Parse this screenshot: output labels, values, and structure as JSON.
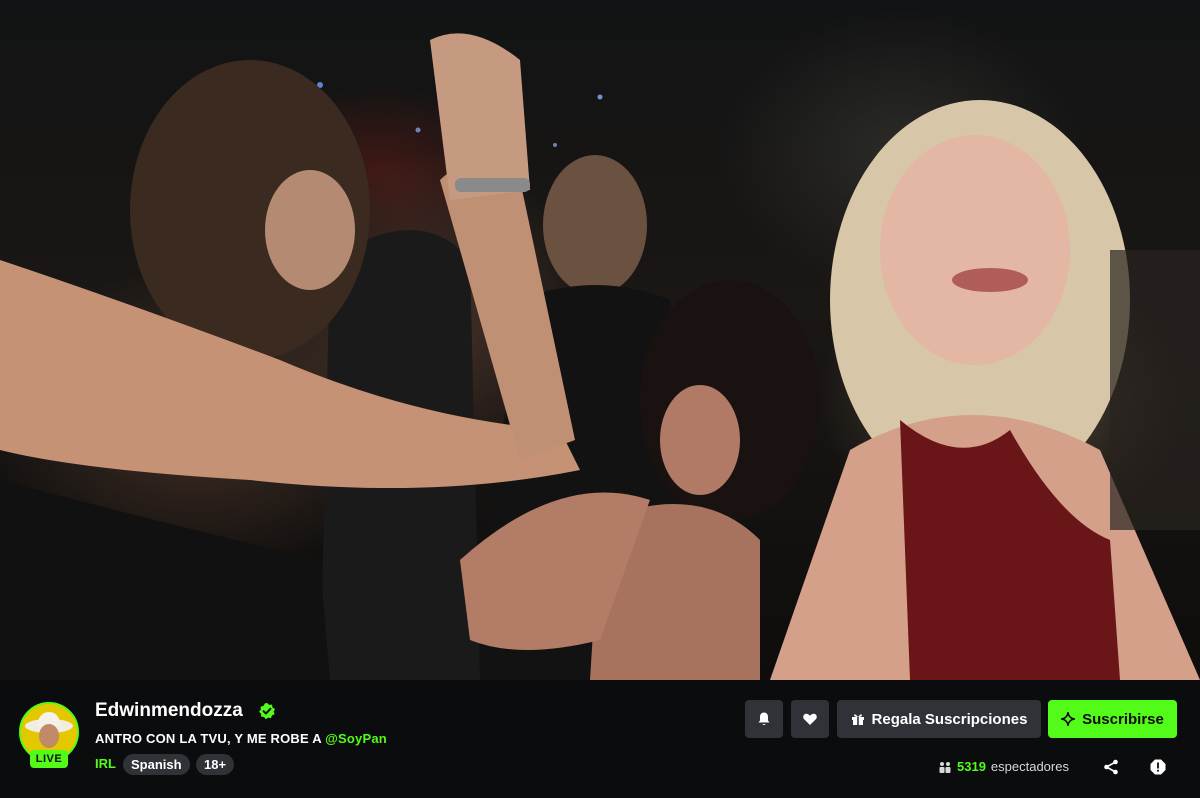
{
  "channel": {
    "name": "Edwinmendozza",
    "live_label": "LIVE",
    "verified_icon": "verified-badge-icon"
  },
  "stream": {
    "title_prefix": "ANTRO CON LA TVU, Y ME ROBE A ",
    "title_mention": "@SoyPan",
    "category": "IRL",
    "tags": [
      "Spanish",
      "18+"
    ]
  },
  "actions": {
    "notify_icon": "bell-icon",
    "follow_icon": "heart-icon",
    "gift_label": "Regala Suscripciones",
    "subscribe_label": "Suscribirse"
  },
  "viewers": {
    "count": "5319",
    "label": "espectadores"
  },
  "colors": {
    "accent": "#53fc18",
    "button_bg": "#2f3236",
    "background": "#0b0c0e"
  }
}
